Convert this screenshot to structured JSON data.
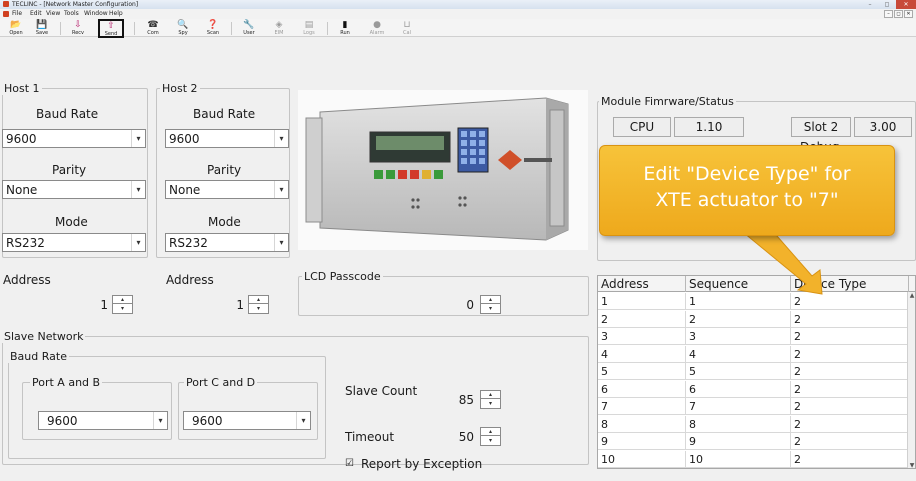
{
  "window": {
    "title": "TECLINC - [Network Master Configuration]",
    "controls": {
      "min": "–",
      "max": "◻",
      "close": "✕"
    }
  },
  "menu": {
    "items": [
      "File",
      "Edit",
      "View",
      "Tools",
      "Window",
      "Help"
    ],
    "mdi_controls": [
      "–",
      "◻",
      "✕"
    ]
  },
  "toolbar": {
    "buttons": [
      {
        "label": "Open",
        "icon": "open-folder-icon",
        "glyph": "📂"
      },
      {
        "label": "Save",
        "icon": "save-disk-icon",
        "glyph": "💾"
      },
      {
        "label": "Recv",
        "icon": "receive-icon",
        "glyph": "⇩"
      },
      {
        "label": "Send",
        "icon": "send-icon",
        "glyph": "⇧",
        "selected": true
      },
      {
        "label": "Com",
        "icon": "com-port-icon",
        "glyph": "☎"
      },
      {
        "label": "Spy",
        "icon": "spy-magnifier-icon",
        "glyph": "🔍"
      },
      {
        "label": "Scan",
        "icon": "scan-help-icon",
        "glyph": "❓"
      },
      {
        "label": "User",
        "icon": "user-wrench-icon",
        "glyph": "🔧"
      },
      {
        "label": "EIM",
        "icon": "eim-icon",
        "glyph": "◈",
        "disabled": true
      },
      {
        "label": "Logs",
        "icon": "logs-icon",
        "glyph": "▤",
        "disabled": true
      },
      {
        "label": "Run",
        "icon": "run-traffic-light-icon",
        "glyph": "▮"
      },
      {
        "label": "Alarm",
        "icon": "alarm-icon",
        "glyph": "●",
        "disabled": true
      },
      {
        "label": "Cal",
        "icon": "calibrate-icon",
        "glyph": "⊔",
        "disabled": true
      }
    ]
  },
  "host1": {
    "title": "Host 1",
    "baud_label": "Baud Rate",
    "baud_value": "9600",
    "parity_label": "Parity",
    "parity_value": "None",
    "mode_label": "Mode",
    "mode_value": "RS232",
    "address_label": "Address",
    "address_value": "1"
  },
  "host2": {
    "title": "Host 2",
    "baud_label": "Baud Rate",
    "baud_value": "9600",
    "parity_label": "Parity",
    "parity_value": "None",
    "mode_label": "Mode",
    "mode_value": "RS232",
    "address_label": "Address",
    "address_value": "1"
  },
  "lcd": {
    "title": "LCD Passcode",
    "value": "0"
  },
  "slave_network": {
    "title": "Slave Network",
    "baud_title": "Baud Rate",
    "port_ab_title": "Port A and B",
    "port_ab_value": "9600",
    "port_cd_title": "Port C and D",
    "port_cd_value": "9600",
    "slave_count_label": "Slave Count",
    "slave_count_value": "85",
    "timeout_label": "Timeout",
    "timeout_value": "50",
    "report_checkbox": "☑",
    "report_label": "Report by Exception"
  },
  "module_fw": {
    "title": "Module Fimrware/Status",
    "cpu_label": "CPU",
    "cpu_value": "1.10",
    "slot_label": "Slot 2",
    "slot_value": "3.00",
    "debug_label": "Debug"
  },
  "callout": {
    "line1": "Edit \"Device Type\" for",
    "line2": "XTE actuator to \"7\"",
    "colors": {
      "fill": "#f2b22b",
      "arrow": "#f2b22b"
    }
  },
  "device_table": {
    "columns": [
      "Address",
      "Sequence",
      "Device Type"
    ],
    "rows": [
      [
        "1",
        "1",
        "2"
      ],
      [
        "2",
        "2",
        "2"
      ],
      [
        "3",
        "3",
        "2"
      ],
      [
        "4",
        "4",
        "2"
      ],
      [
        "5",
        "5",
        "2"
      ],
      [
        "6",
        "6",
        "2"
      ],
      [
        "7",
        "7",
        "2"
      ],
      [
        "8",
        "8",
        "2"
      ],
      [
        "9",
        "9",
        "2"
      ],
      [
        "10",
        "10",
        "2"
      ]
    ]
  }
}
